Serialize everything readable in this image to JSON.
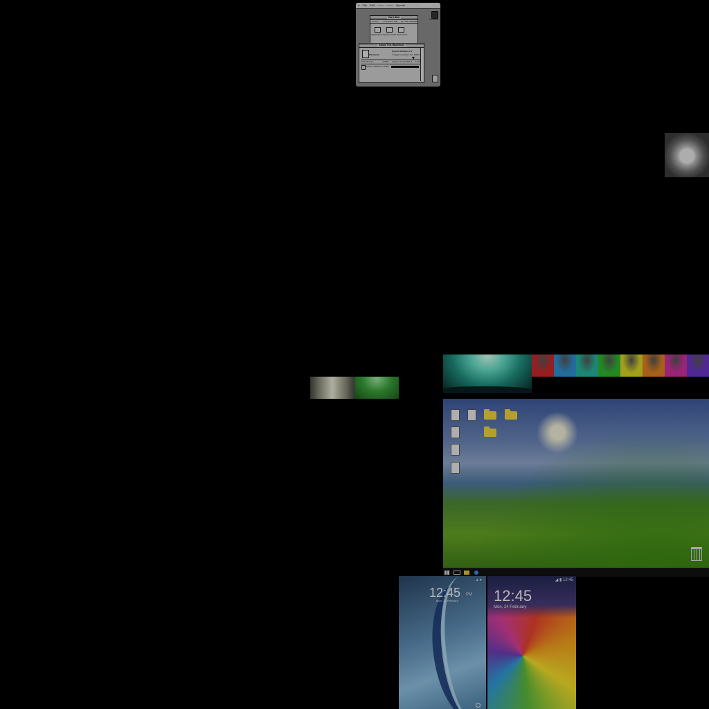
{
  "mac": {
    "menu": {
      "apple": "●",
      "file": "File",
      "edit": "Edit",
      "view": "View",
      "label": "Label",
      "special": "Special",
      "clock": "6:31 PM"
    },
    "hard_disk": {
      "title": "Hard Disk",
      "info_left": "3 items",
      "info_mid": "17,970K in disk",
      "info_right": "10,174K available",
      "items": [
        "Applications",
        "System Folder",
        "Documents"
      ]
    },
    "about": {
      "title": "About This Macintosh",
      "model": "Macintosh",
      "system": "System Software 7.0",
      "copyright": "© Apple Computer, Inc. 1983-1991",
      "total_memory_label": "Total Memory:",
      "total_memory": "4,096K",
      "largest_block_label": "Largest Unused Block:",
      "largest_block": "2,417K",
      "row_label": "System Software",
      "row_value": "1,628K"
    },
    "desktop_disk_label": "Hard Disk"
  },
  "swatches": [
    "#c8282c",
    "#2f8fd0",
    "#25b29a",
    "#2fb52f",
    "#d6d424",
    "#e07f21",
    "#cf2f9f",
    "#6a35c8"
  ],
  "desktop": {
    "taskbar_icons": [
      "apps-icon",
      "window-icon",
      "folder-icon",
      "browser-icon"
    ]
  },
  "phone1": {
    "time": "12:45",
    "ampm": "PM",
    "status": "▴ ●",
    "date": "Mon, 24 February"
  },
  "phone2": {
    "time": "12:45",
    "status": "◢ ▮ 12:45",
    "date": "Mon, 24 February"
  }
}
